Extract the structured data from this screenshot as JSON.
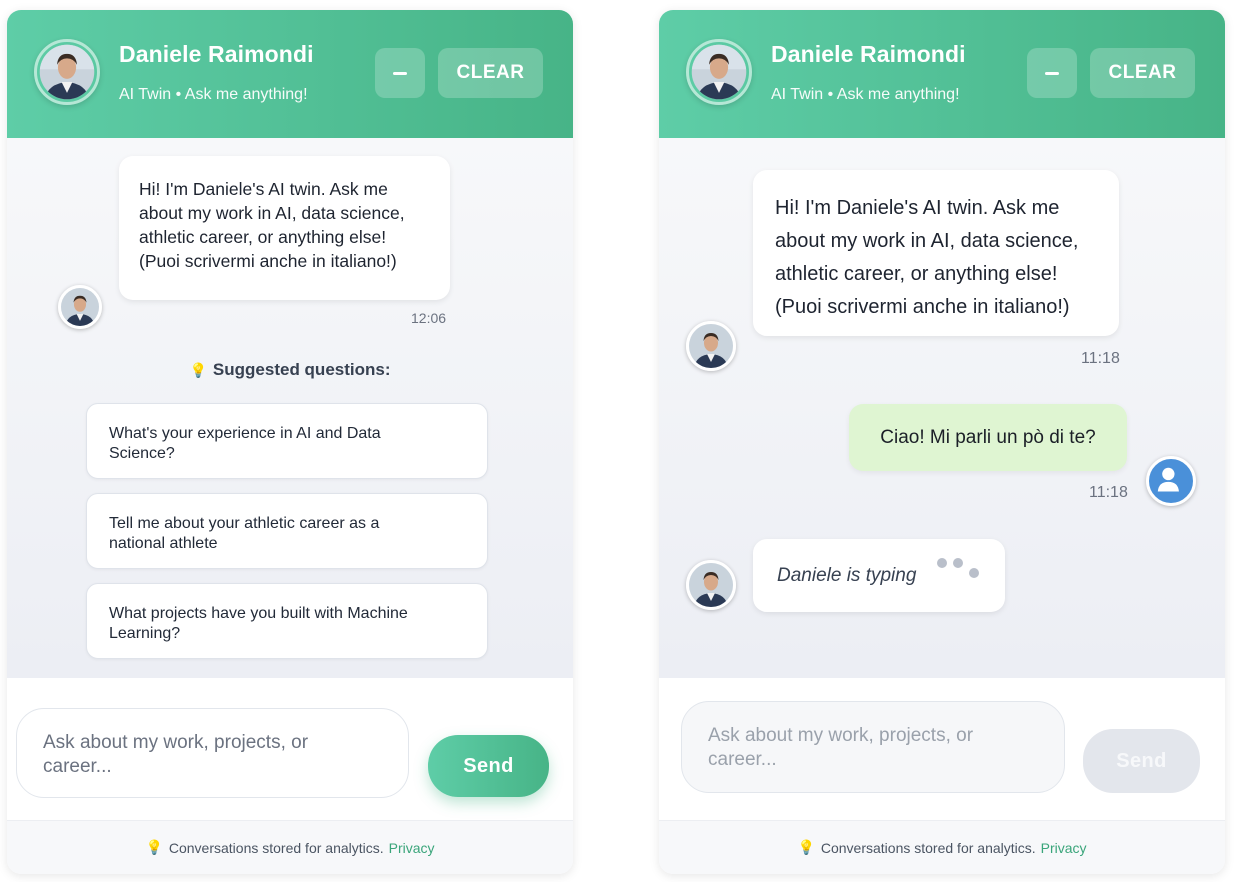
{
  "header": {
    "name": "Daniele Raimondi",
    "subtitle": "AI Twin • Ask me anything!",
    "minimize_label": "–",
    "clear_label": "CLEAR"
  },
  "left_panel": {
    "welcome_message": {
      "lines": [
        "Hi! I'm Daniele's AI twin. Ask me",
        "about my work in AI, data science,",
        "athletic career, or anything else!",
        "(Puoi scrivermi anche in italiano!)"
      ],
      "time": "12:06"
    },
    "suggestions_title": "Suggested questions:",
    "suggestions": [
      {
        "lines": [
          "What's your experience in AI and Data",
          "Science?"
        ]
      },
      {
        "lines": [
          "Tell me about your athletic career as a",
          "national athlete"
        ]
      },
      {
        "lines": [
          "What projects have you built with Machine",
          "Learning?"
        ]
      }
    ],
    "input": {
      "placeholder_lines": [
        "Ask about my work, projects, or",
        "career..."
      ]
    },
    "send_label": "Send"
  },
  "right_panel": {
    "welcome_message": {
      "lines": [
        "Hi! I'm Daniele's AI twin. Ask me",
        "about my work in AI, data science,",
        "athletic career, or anything else!",
        "(Puoi scrivermi anche in italiano!)"
      ],
      "time": "11:18"
    },
    "user_message": {
      "text": "Ciao! Mi parli un pò di te?",
      "time": "11:18"
    },
    "typing_text": "Daniele is typing",
    "input": {
      "placeholder_lines": [
        "Ask about my work, projects, or",
        "career..."
      ]
    },
    "send_label": "Send"
  },
  "footer": {
    "text": "Conversations stored for analytics.",
    "link": "Privacy"
  },
  "colors": {
    "header_start": "#5ecda7",
    "header_end": "#47b487",
    "send_active": "#4fbf93",
    "send_disabled": "#e3e6ec",
    "user_bubble": "#dff5d2",
    "user_avatar": "#4a90d9",
    "privacy_link": "#3aa57a"
  },
  "icons": [
    "lightbulb-icon",
    "user-icon",
    "minus-icon"
  ]
}
